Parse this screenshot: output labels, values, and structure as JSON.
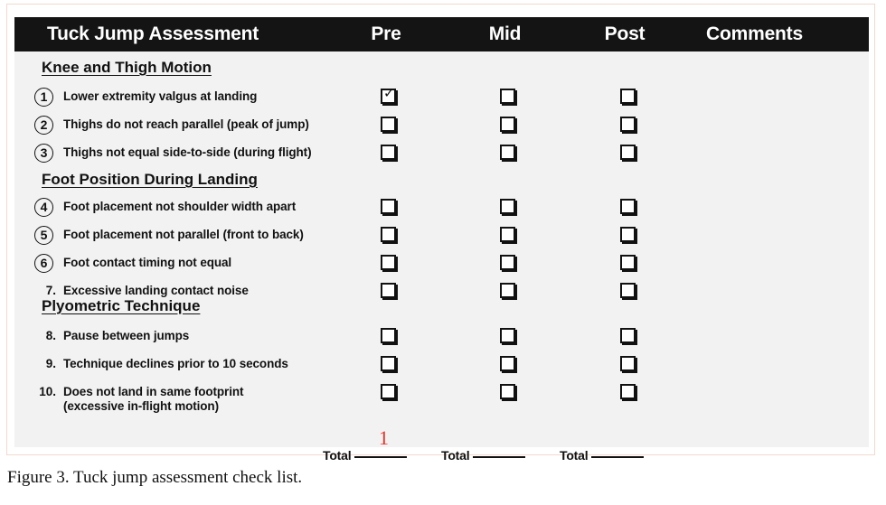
{
  "figure": {
    "caption": "Figure 3. Tuck jump assessment check list.",
    "accent_red": "#e8332a",
    "header_bg": "#141414",
    "sheet_bg": "#f2f2f2"
  },
  "table": {
    "header": {
      "title": "Tuck Jump Assessment",
      "col_pre": "Pre",
      "col_mid": "Mid",
      "col_post": "Post",
      "col_comments": "Comments"
    },
    "sections": [
      {
        "heading": "Knee and Thigh Motion",
        "rows": [
          {
            "number": "1",
            "circled": true,
            "label": "Lower extremity valgus at landing",
            "pre": true,
            "mid": false,
            "post": false
          },
          {
            "number": "2",
            "circled": true,
            "label": "Thighs do not reach parallel (peak of jump)",
            "pre": false,
            "mid": false,
            "post": false
          },
          {
            "number": "3",
            "circled": true,
            "label": "Thighs not equal side-to-side (during flight)",
            "pre": false,
            "mid": false,
            "post": false
          }
        ]
      },
      {
        "heading": "Foot Position During Landing",
        "rows": [
          {
            "number": "4",
            "circled": true,
            "label": "Foot placement not shoulder width apart",
            "pre": false,
            "mid": false,
            "post": false
          },
          {
            "number": "5",
            "circled": true,
            "label": "Foot placement not parallel (front to back)",
            "pre": false,
            "mid": false,
            "post": false
          },
          {
            "number": "6",
            "circled": true,
            "label": "Foot contact timing not equal",
            "pre": false,
            "mid": false,
            "post": false
          },
          {
            "number": "7.",
            "circled": false,
            "label": "Excessive landing contact noise",
            "pre": false,
            "mid": false,
            "post": false
          }
        ]
      },
      {
        "heading": "Plyometric Technique",
        "rows": [
          {
            "number": "8.",
            "circled": false,
            "label": "Pause between jumps",
            "pre": false,
            "mid": false,
            "post": false
          },
          {
            "number": "9.",
            "circled": false,
            "label": "Technique declines prior to 10 seconds",
            "pre": false,
            "mid": false,
            "post": false
          },
          {
            "number": "10.",
            "circled": false,
            "label": "Does not land in same footprint",
            "label2": "(excessive in-flight motion)",
            "pre": false,
            "mid": false,
            "post": false
          }
        ]
      }
    ],
    "totals": {
      "label": "Total",
      "pre_value": "1",
      "mid_value": "",
      "post_value": ""
    },
    "check_glyph": "✓"
  }
}
